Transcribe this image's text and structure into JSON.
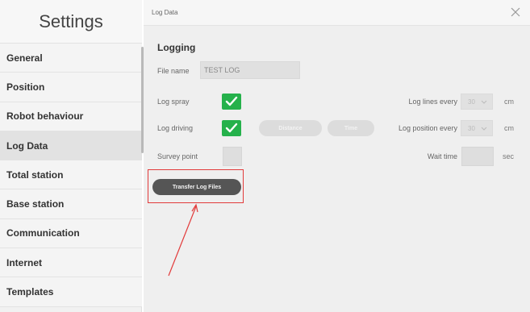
{
  "sidebar": {
    "title": "Settings",
    "items": [
      {
        "label": "General"
      },
      {
        "label": "Position"
      },
      {
        "label": "Robot behaviour"
      },
      {
        "label": "Log Data",
        "active": true
      },
      {
        "label": "Total station"
      },
      {
        "label": "Base station"
      },
      {
        "label": "Communication"
      },
      {
        "label": "Internet"
      },
      {
        "label": "Templates"
      }
    ]
  },
  "panel": {
    "title": "Log Data",
    "close_icon": "close-icon",
    "section_title": "Logging",
    "file_name_label": "File name",
    "file_name_value": "TEST LOG",
    "log_spray_label": "Log spray",
    "log_spray_checked": true,
    "log_driving_label": "Log driving",
    "log_driving_checked": true,
    "survey_point_label": "Survey point",
    "survey_point_checked": false,
    "distance_button": "Distance",
    "time_button": "Time",
    "log_lines_label": "Log lines every",
    "log_lines_value": "30",
    "log_lines_unit": "cm",
    "log_position_label": "Log position every",
    "log_position_value": "30",
    "log_position_unit": "cm",
    "wait_time_label": "Wait time",
    "wait_time_unit": "sec",
    "transfer_button": "Transfer Log Files"
  },
  "annotation": {
    "color": "#e23b3b"
  },
  "colors": {
    "check_green": "#25b14b",
    "dark_button": "#555555"
  }
}
